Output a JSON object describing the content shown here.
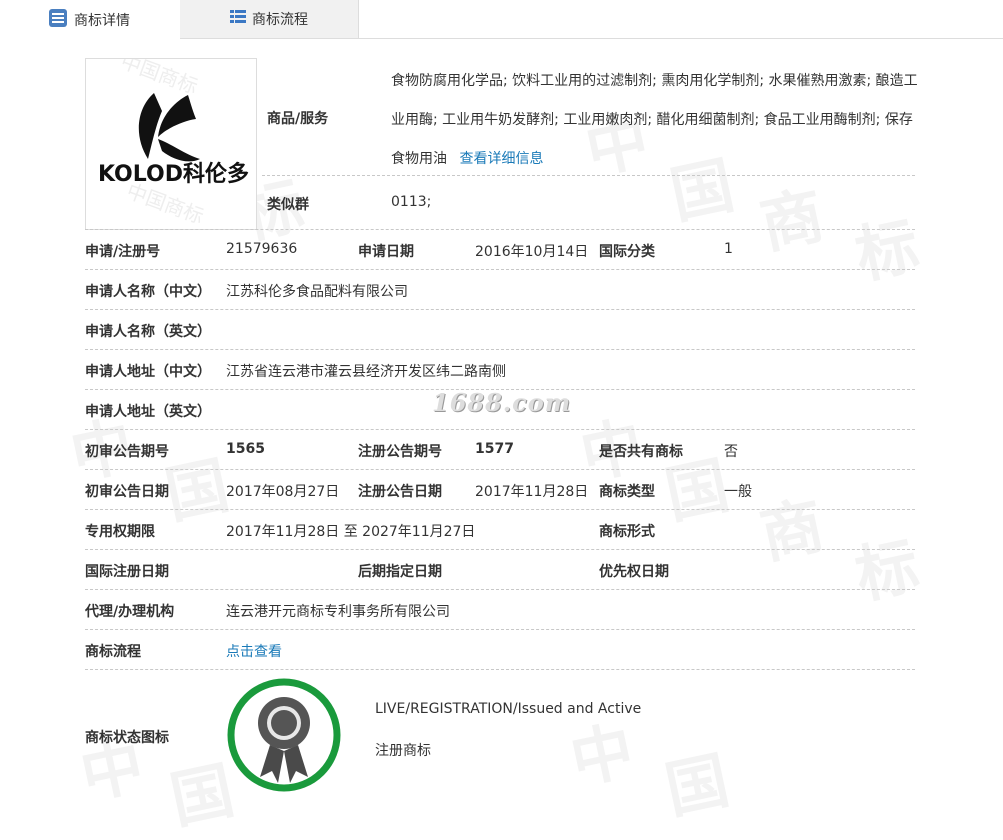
{
  "tabs": [
    {
      "label": "商标详情",
      "active": true,
      "icon": "list-doc-icon"
    },
    {
      "label": "商标流程",
      "active": false,
      "icon": "list-grid-icon"
    }
  ],
  "logo": {
    "brand_text": "KOLOD科伦多"
  },
  "goods_services": {
    "label": "商品/服务",
    "text": "食物防腐用化学品; 饮料工业用的过滤制剂; 熏肉用化学制剂; 水果催熟用激素; 酿造工业用酶; 工业用牛奶发酵剂; 工业用嫩肉剂; 醋化用细菌制剂; 食品工业用酶制剂; 保存食物用油",
    "more_link": "查看详细信息"
  },
  "similar_group": {
    "label": "类似群",
    "value": "0113;"
  },
  "rows": {
    "reg_no": {
      "label": "申请/注册号",
      "value": "21579636"
    },
    "apply_date": {
      "label": "申请日期",
      "value": "2016年10月14日"
    },
    "intl_class": {
      "label": "国际分类",
      "value": "1"
    },
    "applicant_cn": {
      "label": "申请人名称（中文）",
      "value": "江苏科伦多食品配料有限公司"
    },
    "applicant_en": {
      "label": "申请人名称（英文）",
      "value": ""
    },
    "address_cn": {
      "label": "申请人地址（中文）",
      "value": "江苏省连云港市灌云县经济开发区纬二路南侧"
    },
    "address_en": {
      "label": "申请人地址（英文）",
      "value": ""
    },
    "prelim_pub_no": {
      "label": "初审公告期号",
      "value": "1565"
    },
    "reg_pub_no": {
      "label": "注册公告期号",
      "value": "1577"
    },
    "shared": {
      "label": "是否共有商标",
      "value": "否"
    },
    "prelim_pub_date": {
      "label": "初审公告日期",
      "value": "2017年08月27日"
    },
    "reg_pub_date": {
      "label": "注册公告日期",
      "value": "2017年11月28日"
    },
    "tm_type": {
      "label": "商标类型",
      "value": "一般"
    },
    "exclusive_period": {
      "label": "专用权期限",
      "value": "2017年11月28日 至 2027年11月27日"
    },
    "tm_form": {
      "label": "商标形式",
      "value": ""
    },
    "intl_reg_date": {
      "label": "国际注册日期",
      "value": ""
    },
    "later_designation": {
      "label": "后期指定日期",
      "value": ""
    },
    "priority_date": {
      "label": "优先权日期",
      "value": ""
    },
    "agent": {
      "label": "代理/办理机构",
      "value": "连云港开元商标专利事务所有限公司"
    },
    "process": {
      "label": "商标流程",
      "link": "点击查看"
    }
  },
  "status": {
    "label": "商标状态图标",
    "en": "LIVE/REGISTRATION/Issued and Active",
    "cn": "注册商标",
    "icon": "award-ribbon-icon",
    "ring_color": "#1a9a3c"
  },
  "watermark": {
    "site": "1688.com",
    "chars": [
      "中",
      "国",
      "商",
      "标"
    ]
  }
}
